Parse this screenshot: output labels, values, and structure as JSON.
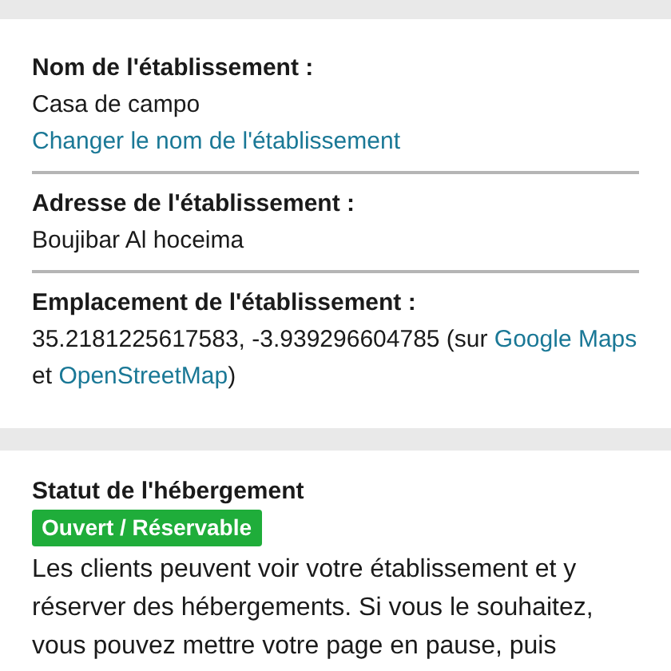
{
  "property": {
    "fields": [
      {
        "kind": "text",
        "label": "Nom de l'établissement :",
        "value": "Casa de campo",
        "link": "Changer le nom de l'établissement"
      },
      {
        "kind": "text",
        "label": "Adresse de l'établissement :",
        "value": "Boujibar Al hoceima"
      },
      {
        "kind": "location",
        "label": "Emplacement de l'établissement :",
        "parts": [
          {
            "kind": "text",
            "text": "35.2181225617583, -3.939296604785 (sur "
          },
          {
            "kind": "link",
            "text": "Google Maps"
          },
          {
            "kind": "text",
            "text": " et "
          },
          {
            "kind": "link",
            "text": "OpenStreetMap"
          },
          {
            "kind": "text",
            "text": ")"
          }
        ]
      }
    ]
  },
  "status": {
    "title": "Statut de l'hébergement",
    "badge": "Ouvert / Réservable",
    "open": true,
    "description": "Les clients peuvent voir votre établissement et y réserver des hébergements. Si vous le souhaitez, vous pouvez mettre votre page en pause, puis"
  }
}
